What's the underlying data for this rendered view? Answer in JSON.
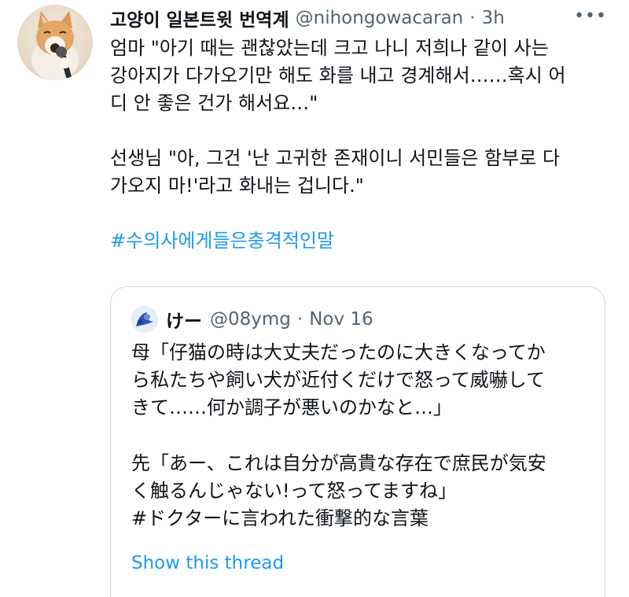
{
  "tweet": {
    "display_name": "고양이 일본트윗 번역계",
    "handle": "@nihongowacaran",
    "separator": "·",
    "time": "3h",
    "more_label": "•••",
    "body_lines_1": [
      "엄마 \"아기 때는 괜찮았는데 크고 나니 저희나 같이 사는",
      "강아지가 다가오기만 해도 화를 내고 경계해서……혹시 어",
      "디 안 좋은 건가 해서요…\""
    ],
    "body_lines_2": [
      "선생님 \"아, 그건 '난 고귀한 존재이니 서민들은 함부로 다",
      "가오지 마!'라고 화내는 겁니다.\""
    ],
    "hashtag": "#수의사에게들은충격적인말",
    "avatar_icon": "cat-singing-microphone"
  },
  "quote": {
    "display_name": "けー",
    "handle": "@08ymg",
    "separator": "·",
    "time": "Nov 16",
    "avatar_icon": "blue-flower-avatar",
    "body_lines_1": [
      "母「仔猫の時は大丈夫だったのに大きくなってか",
      "ら私たちや飼い犬が近付くだけで怒って威嚇して",
      "きて……何か調子が悪いのかなと…」"
    ],
    "body_lines_2": [
      "先「あー、これは自分が高貴な存在で庶民が気安",
      "く触るんじゃない!って怒ってますね」",
      "#ドクターに言われた衝撃的な言葉"
    ],
    "show_thread": "Show this thread"
  },
  "colors": {
    "text_primary": "#0f1419",
    "text_secondary": "#536471",
    "link": "#1d9bf0",
    "border": "#cfd9de"
  }
}
